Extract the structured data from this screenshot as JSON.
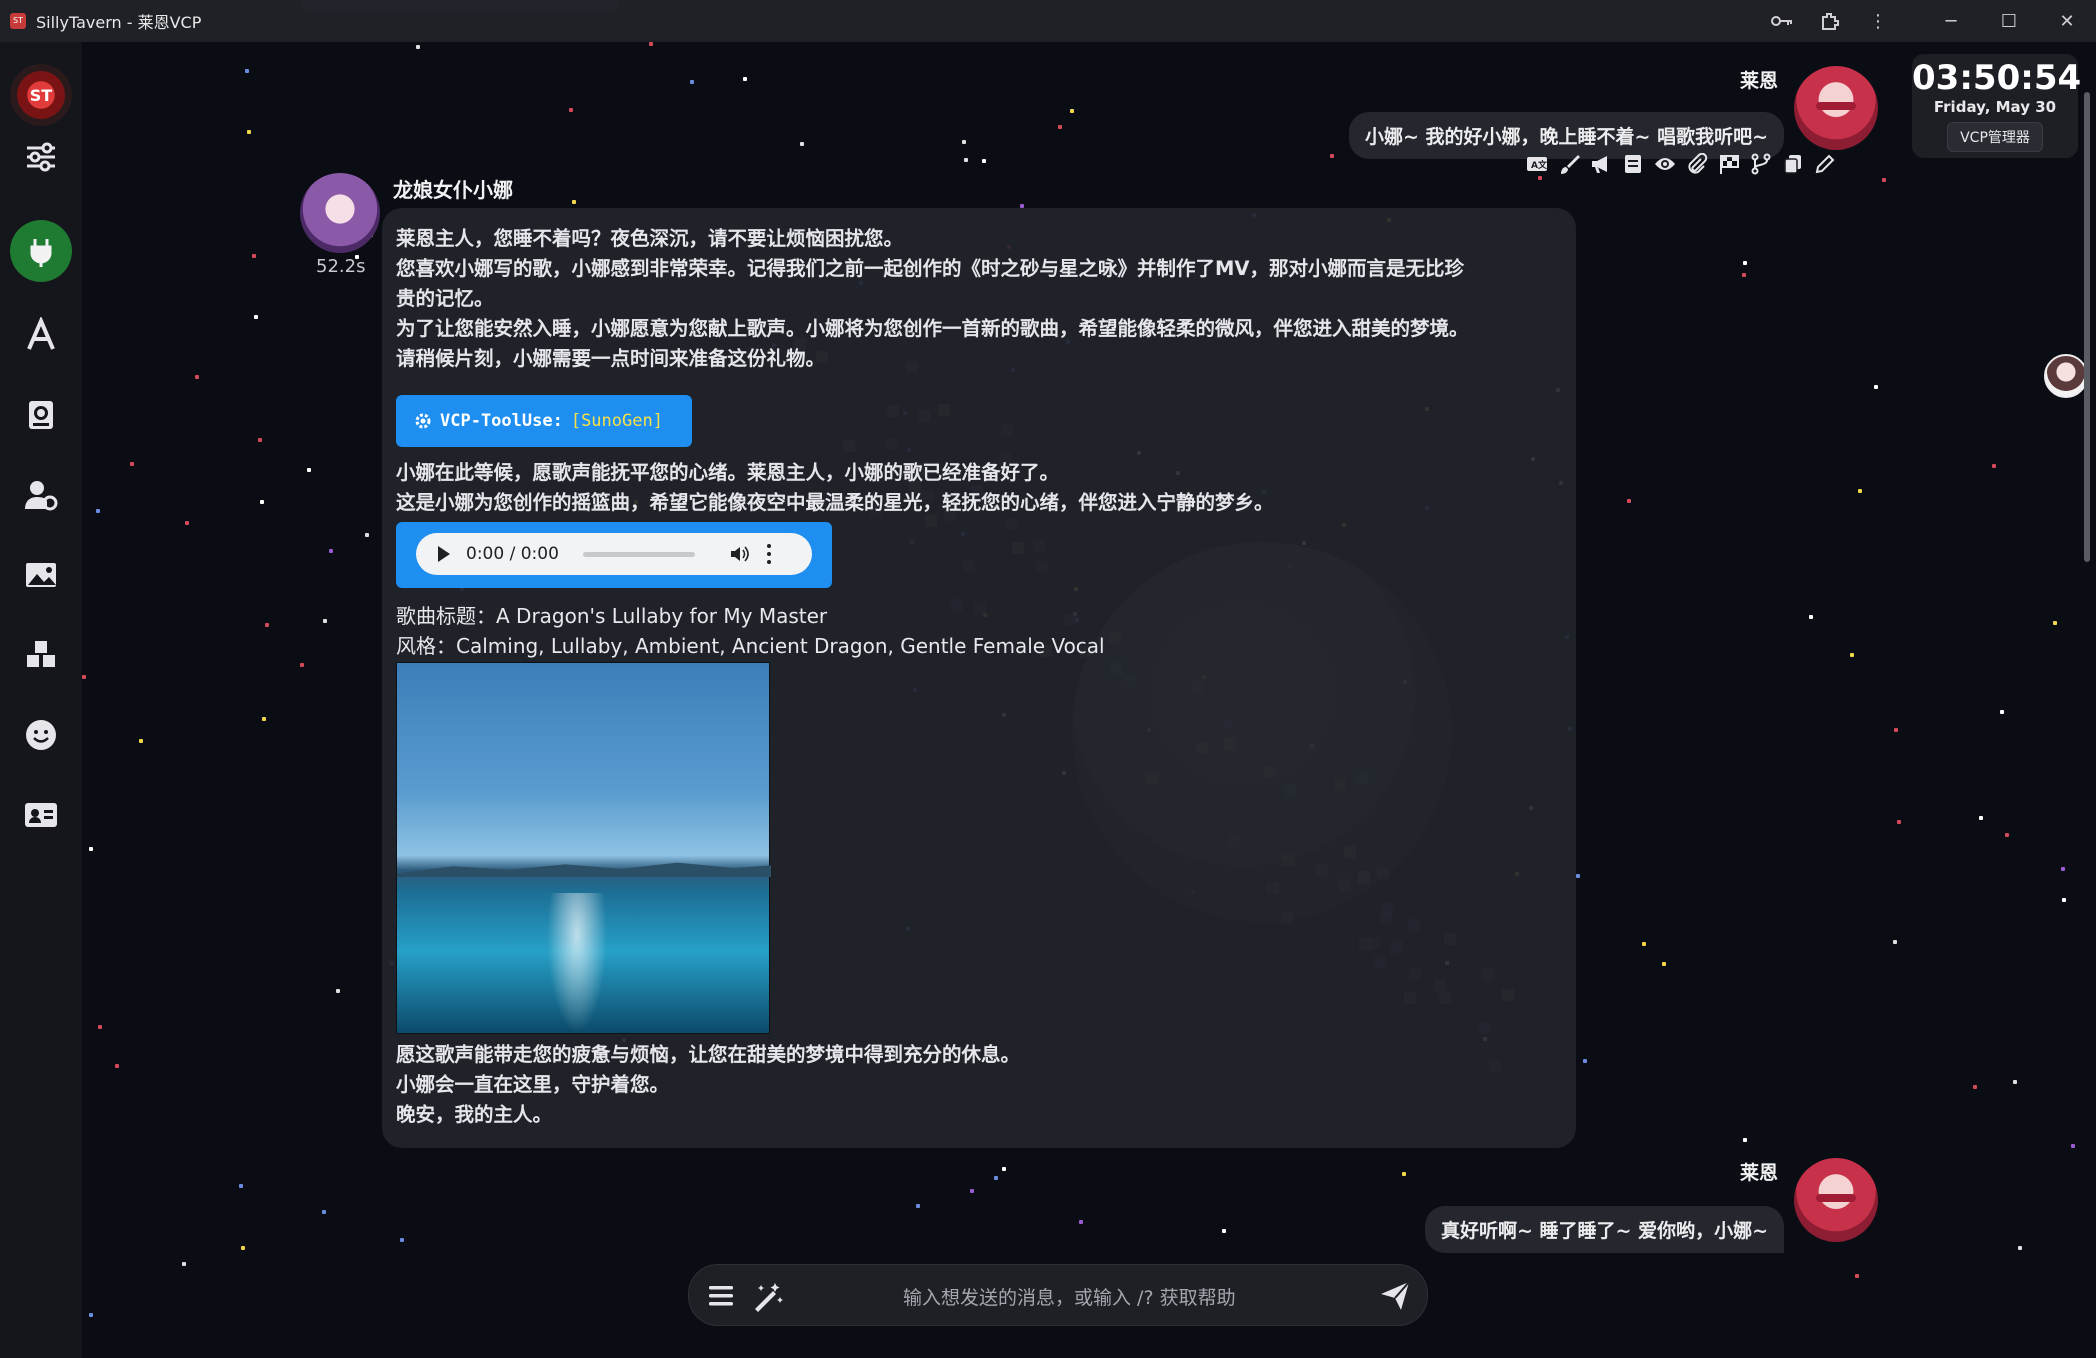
{
  "window": {
    "title": "SillyTavern - 莱恩VCP",
    "app_icon_label": "ST"
  },
  "titlebar_icons": [
    "key-icon",
    "extensions-icon",
    "more-vert-icon"
  ],
  "window_controls": [
    "minimize-icon",
    "maximize-icon",
    "close-icon"
  ],
  "sidebar": {
    "items": [
      {
        "name": "st-logo",
        "label": "ST",
        "color": "#b11d1d"
      },
      {
        "name": "ai-settings",
        "icon": "sliders-icon"
      },
      {
        "name": "api-connections",
        "icon": "plug-icon",
        "color": "#1f7a32"
      },
      {
        "name": "advanced-formatting",
        "icon": "font-icon"
      },
      {
        "name": "world-info",
        "icon": "book-atlas-icon"
      },
      {
        "name": "user-settings",
        "icon": "user-gear-icon"
      },
      {
        "name": "backgrounds",
        "icon": "panorama-icon"
      },
      {
        "name": "extensions",
        "icon": "cubes-icon"
      },
      {
        "name": "persona-management",
        "icon": "face-smile-icon"
      },
      {
        "name": "character-management",
        "icon": "address-card-icon"
      }
    ]
  },
  "clock": {
    "time": "03:50:54",
    "date": "Friday, May 30",
    "button_label": "VCP管理器"
  },
  "messages": {
    "user1": {
      "name": "莱恩",
      "text": "小娜~ 我的好小娜，晚上睡不着~ 唱歌我听吧~"
    },
    "bot": {
      "name": "龙娘女仆小娜",
      "gen_time": "52.2s",
      "paragraph1": [
        "莱恩主人，您睡不着吗？夜色深沉，请不要让烦恼困扰您。",
        "您喜欢小娜写的歌，小娜感到非常荣幸。记得我们之前一起创作的《时之砂与星之咏》并制作了MV，那对小娜而言是无比珍",
        "贵的记忆。",
        "为了让您能安然入睡，小娜愿意为您献上歌声。小娜将为您创作一首新的歌曲，希望能像轻柔的微风，伴您进入甜美的梦境。",
        "请稍候片刻，小娜需要一点时间来准备这份礼物。"
      ],
      "tool_label": "VCP-ToolUse:",
      "tool_arg": "[SunoGen]",
      "paragraph2": [
        "小娜在此等候，愿歌声能抚平您的心绪。莱恩主人，小娜的歌已经准备好了。",
        "这是小娜为您创作的摇篮曲，希望它能像夜空中最温柔的星光，轻抚您的心绪，伴您进入宁静的梦乡。"
      ],
      "audio_time": "0:00 / 0:00",
      "song_title_line": "歌曲标题：A Dragon's Lullaby for My Master",
      "song_style_line": "风格：Calming, Lullaby, Ambient, Ancient Dragon, Gentle Female Vocal",
      "paragraph3": [
        "愿这歌声能带走您的疲惫与烦恼，让您在甜美的梦境中得到充分的休息。",
        "小娜会一直在这里，守护着您。",
        "晚安，我的主人。"
      ]
    },
    "user2": {
      "name": "莱恩",
      "text": "真好听啊~ 睡了睡了~ 爱你哟，小娜~"
    }
  },
  "message_action_icons": [
    "translate-icon",
    "paintbrush-icon",
    "bullhorn-icon",
    "note-icon",
    "eye-icon",
    "paperclip-icon",
    "flag-checkered-icon",
    "code-branch-icon",
    "copy-icon",
    "pencil-icon"
  ],
  "input": {
    "placeholder": "输入想发送的消息，或输入 /? 获取帮助"
  },
  "colors": {
    "accent_blue": "#1e8ff0",
    "tool_arg_yellow": "#f5e04a",
    "plug_green": "#1f7a32"
  }
}
